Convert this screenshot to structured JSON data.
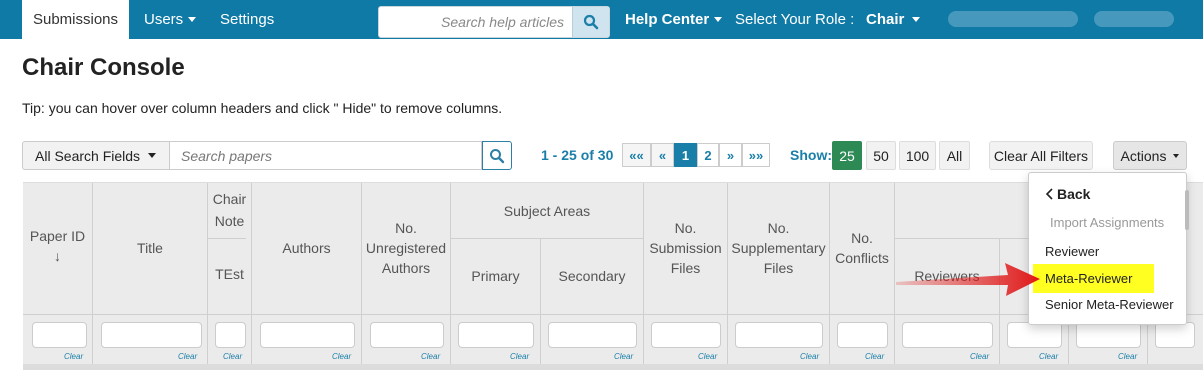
{
  "topnav": {
    "active_tab": "Submissions",
    "users": "Users",
    "settings": "Settings",
    "help_search_placeholder": "Search help articles",
    "help_center": "Help Center",
    "role_label": "Select Your Role :",
    "role_value": "Chair"
  },
  "page": {
    "title": "Chair Console",
    "tip": "Tip: you can hover over column headers and click \" Hide\" to remove columns."
  },
  "toolbar": {
    "search_fields": "All Search Fields",
    "search_placeholder": "Search papers",
    "range_prefix": "1 - 25 of ",
    "range_total": "30",
    "pager_first": "««",
    "pager_prev": "«",
    "pager_page1": "1",
    "pager_page2": "2",
    "pager_next": "»",
    "pager_last": "»»",
    "show_label": "Show:",
    "size_25": "25",
    "size_50": "50",
    "size_100": "100",
    "size_all": "All",
    "clear_filters": "Clear All Filters",
    "actions": "Actions"
  },
  "table": {
    "headers": {
      "paper_id": "Paper ID",
      "sort_arrow": "↓",
      "title": "Title",
      "chair_note": "Chair Note",
      "chair_note_sub": "TEst",
      "authors": "Authors",
      "unregistered": "No. Unregistered Authors",
      "subject_areas": "Subject Areas",
      "primary": "Primary",
      "secondary": "Secondary",
      "submission_files": "No. Submission Files",
      "supplementary_files": "No. Supplementary Files",
      "conflicts": "No. Conflicts",
      "reviewers": "Reviewers"
    },
    "clear_label": "Clear"
  },
  "actions_menu": {
    "back": "Back",
    "import": "Import Assignments",
    "reviewer": "Reviewer",
    "meta_reviewer": "Meta-Reviewer",
    "senior_meta_reviewer": "Senior Meta-Reviewer"
  },
  "colors": {
    "nav": "#0f7aa5",
    "link": "#1a7fa8",
    "active_size": "#2d8a54",
    "highlight": "#ffff22",
    "arrow": "#e01818"
  }
}
